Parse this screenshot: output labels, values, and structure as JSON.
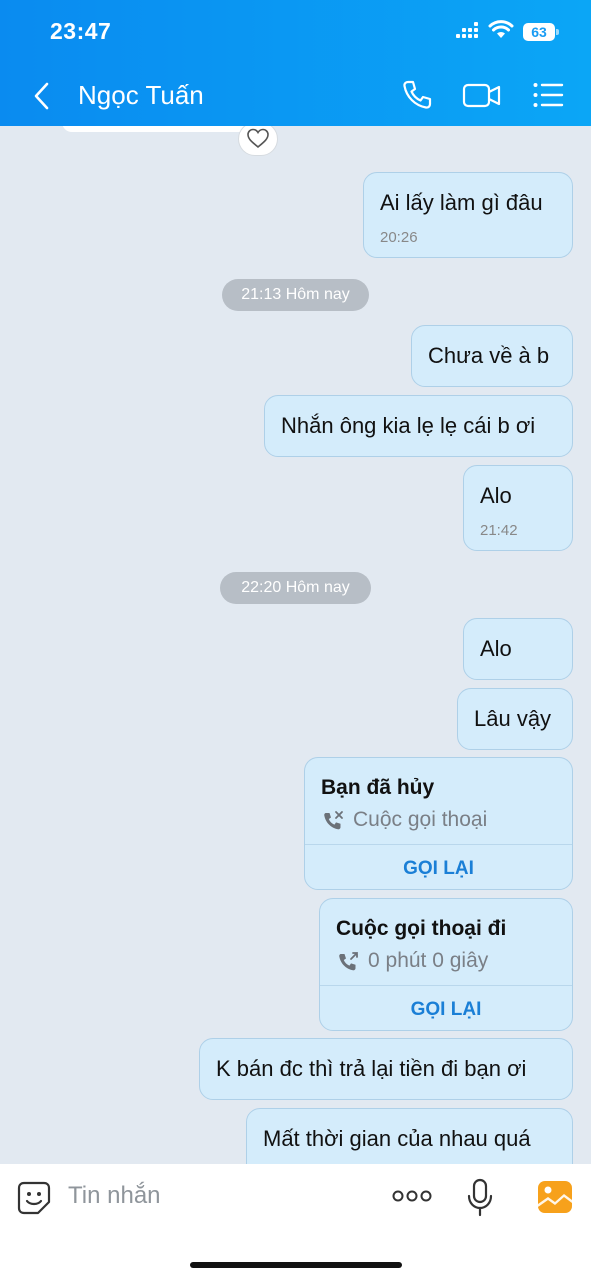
{
  "status_bar": {
    "time": "23:47",
    "battery": "63"
  },
  "header": {
    "title": "Ngọc Tuấn"
  },
  "messages": {
    "m1": {
      "text": "Ai lấy làm gì đâu",
      "time": "20:26"
    },
    "sep1": "21:13 Hôm nay",
    "m2": {
      "text": "Chưa về à b"
    },
    "m3": {
      "text": "Nhắn ông kia lẹ lẹ cái b ơi"
    },
    "m4": {
      "text": "Alo",
      "time": "21:42"
    },
    "sep2": "22:20 Hôm nay",
    "m5": {
      "text": "Alo"
    },
    "m6": {
      "text": "Lâu vậy"
    },
    "call1": {
      "title": "Bạn đã hủy",
      "subtitle": "Cuộc gọi thoại",
      "button": "GỌI LẠI"
    },
    "call2": {
      "title": "Cuộc gọi thoại đi",
      "subtitle": "0 phút 0 giây",
      "button": "GỌI LẠI"
    },
    "m7": {
      "text": "K bán đc thì trả lại tiền đi bạn ơi"
    },
    "m8": {
      "text": "Mất thời gian của nhau quá"
    }
  },
  "composer": {
    "placeholder": "Tin nhắn"
  },
  "icons": {
    "back": "chevron-left-icon",
    "call": "phone-icon",
    "video": "video-camera-icon",
    "menu": "list-menu-icon",
    "emoji": "emoji-sticker-icon",
    "more": "more-dots-icon",
    "mic": "microphone-icon",
    "gallery": "image-gallery-icon",
    "heart": "heart-icon"
  },
  "colors": {
    "header": "#0a8bf0",
    "bubble": "#d4ecfb",
    "chat_bg": "#e2e9f1",
    "accent": "#1a7fd6"
  }
}
